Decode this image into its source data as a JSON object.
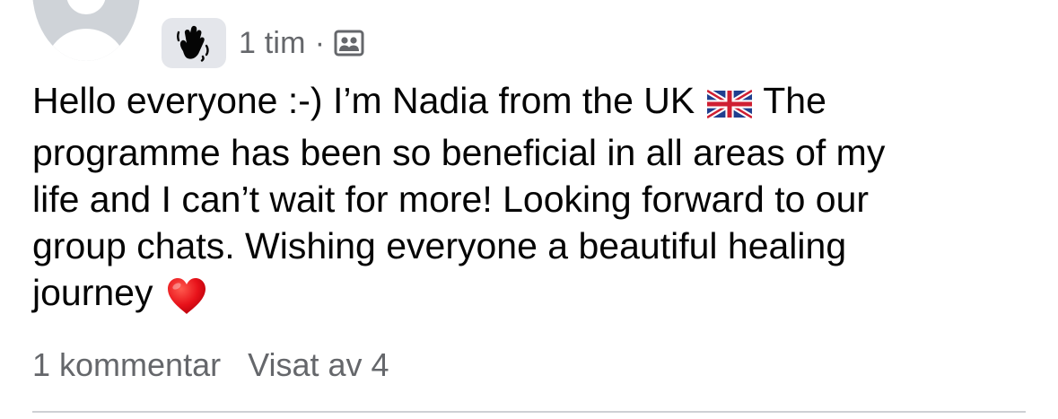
{
  "post": {
    "author_avatar": "default-avatar",
    "badge_icon": "waving-hand-icon",
    "timestamp": "1 tim",
    "separator": "·",
    "audience_icon": "group-members-icon",
    "body_lines": [
      "Hello everyone :-) I’m Nadia from the UK",
      "The",
      "programme has been so beneficial in all areas of my",
      "life and I can’t wait for more! Looking forward to our",
      "group chats. Wishing everyone a beautiful healing",
      "journey"
    ],
    "emojis": [
      "uk-flag",
      "red-heart"
    ]
  },
  "footer": {
    "comments_label": "1 kommentar",
    "views_label": "Visat av 4"
  },
  "colors": {
    "text": "#050505",
    "secondary_text": "#65676b",
    "badge_bg": "#e4e6eb",
    "avatar_bg": "#cfd3d8",
    "divider": "#ced0d4"
  }
}
